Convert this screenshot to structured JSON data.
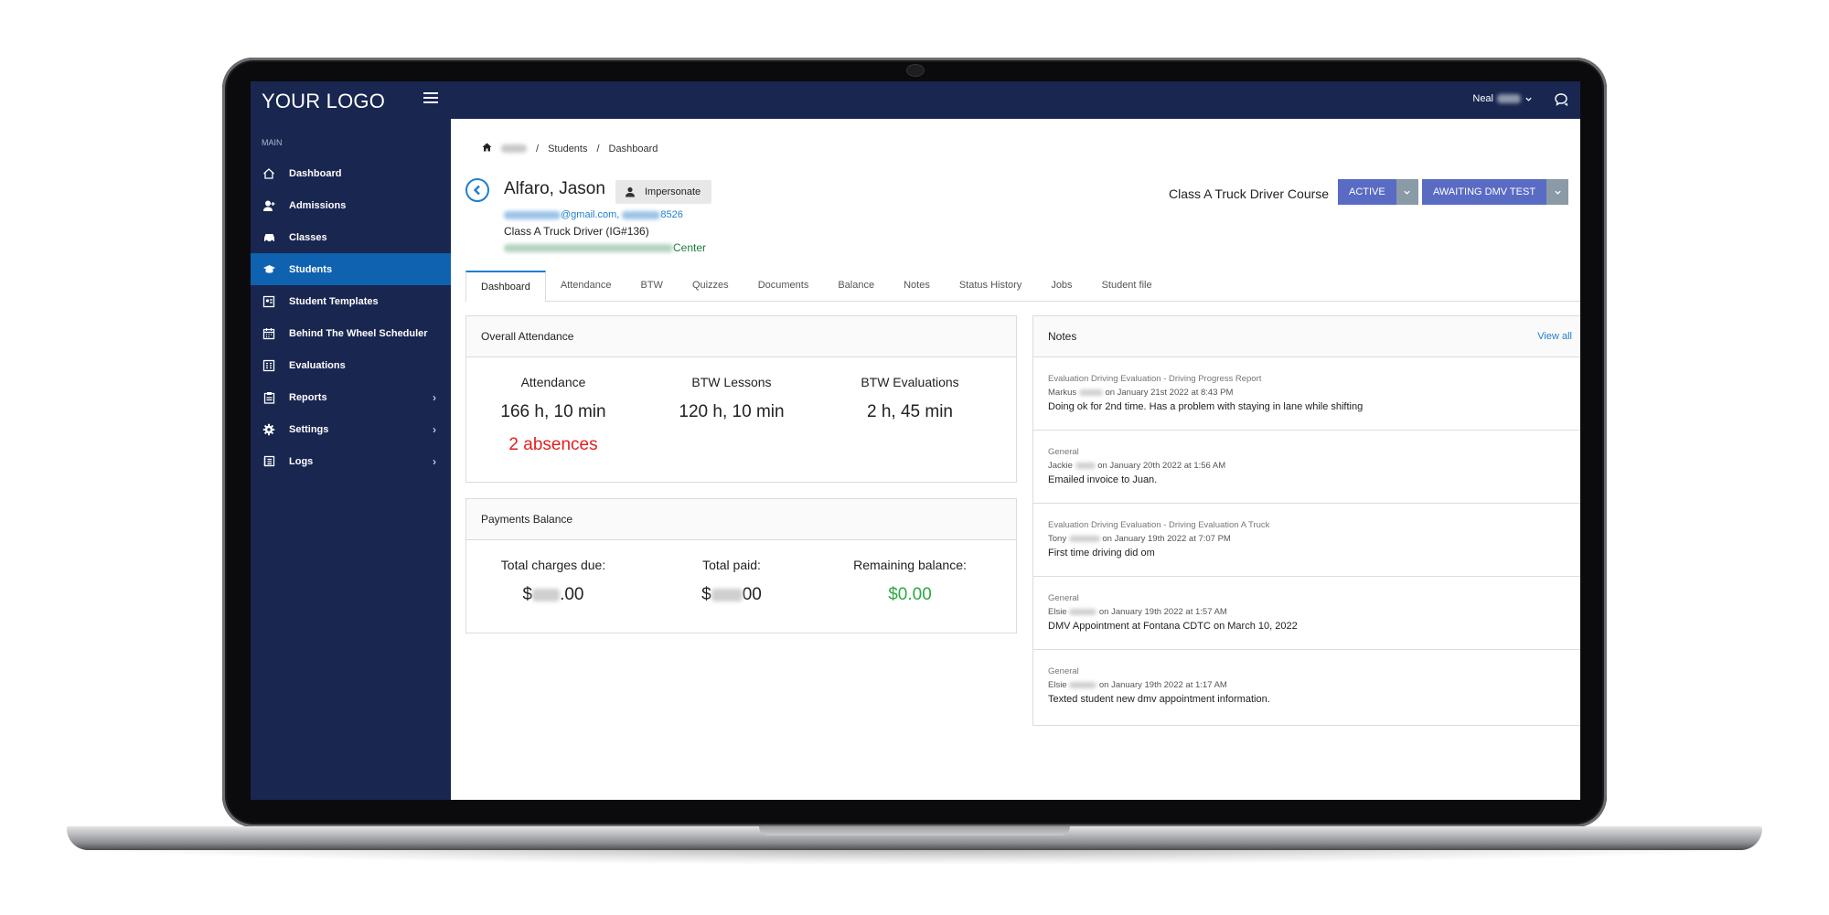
{
  "topbar": {
    "logo": "YOUR LOGO",
    "user_name": "Neal"
  },
  "sidebar": {
    "section": "MAIN",
    "items": [
      {
        "label": "Dashboard",
        "icon": "home-icon"
      },
      {
        "label": "Admissions",
        "icon": "user-add-icon"
      },
      {
        "label": "Classes",
        "icon": "car-icon"
      },
      {
        "label": "Students",
        "icon": "graduation-cap-icon",
        "active": true
      },
      {
        "label": "Student Templates",
        "icon": "id-card-icon"
      },
      {
        "label": "Behind The Wheel Scheduler",
        "icon": "calendar-icon"
      },
      {
        "label": "Evaluations",
        "icon": "checklist-icon"
      },
      {
        "label": "Reports",
        "icon": "clipboard-icon",
        "has_children": true
      },
      {
        "label": "Settings",
        "icon": "gear-icon",
        "has_children": true
      },
      {
        "label": "Logs",
        "icon": "log-icon",
        "has_children": true
      }
    ],
    "chevron": "›"
  },
  "breadcrumb": {
    "items": [
      "Students",
      "Dashboard"
    ],
    "separator": "/"
  },
  "student": {
    "name": "Alfaro, Jason",
    "impersonate_label": "Impersonate",
    "email_suffix": "@gmail.com,",
    "phone_suffix": "8526",
    "program": "Class A Truck Driver (IG#136)",
    "location_suffix": "Center"
  },
  "header": {
    "course_title": "Class A Truck Driver Course",
    "status_label": "ACTIVE",
    "status_color": "#5a6bc4",
    "status_drop_color": "#8a9aa7",
    "stage_label": "AWAITING DMV TEST",
    "stage_color": "#5a6bc4",
    "stage_drop_color": "#8a9aa7"
  },
  "tabs": [
    "Dashboard",
    "Attendance",
    "BTW",
    "Quizzes",
    "Documents",
    "Balance",
    "Notes",
    "Status History",
    "Jobs",
    "Student file"
  ],
  "attendance_card": {
    "title": "Overall Attendance",
    "stats": [
      {
        "label": "Attendance",
        "value": "166 h, 10 min",
        "extra": "2 absences"
      },
      {
        "label": "BTW Lessons",
        "value": "120 h, 10 min"
      },
      {
        "label": "BTW Evaluations",
        "value": "2 h, 45 min"
      }
    ]
  },
  "payments_card": {
    "title": "Payments Balance",
    "stats": [
      {
        "label": "Total charges due:",
        "prefix": "$",
        "suffix": ".00"
      },
      {
        "label": "Total paid:",
        "prefix": "$",
        "suffix": "00"
      },
      {
        "label": "Remaining balance:",
        "value": "$0.00"
      }
    ]
  },
  "notes_card": {
    "title": "Notes",
    "view_all": "View all",
    "notes": [
      {
        "type": "Evaluation Driving Evaluation - Driving Progress Report",
        "author": "Markus",
        "date": "on January 21st 2022 at 8:43 PM",
        "text": "Doing ok for 2nd time. Has a problem with staying in lane while shifting"
      },
      {
        "type": "General",
        "author": "Jackie",
        "date": "on January 20th 2022 at 1:56 AM",
        "text": "Emailed invoice to Juan."
      },
      {
        "type": "Evaluation Driving Evaluation - Driving Evaluation A Truck",
        "author": "Tony",
        "date": "on January 19th 2022 at 7:07 PM",
        "text": "First time driving did om"
      },
      {
        "type": "General",
        "author": "Elsie",
        "date": "on January 19th 2022 at 1:57 AM",
        "text": "DMV Appointment at Fontana CDTC on March 10, 2022"
      },
      {
        "type": "General",
        "author": "Elsie",
        "date": "on January 19th 2022 at 1:17 AM",
        "text": "Texted student new dmv appointment information."
      }
    ]
  }
}
